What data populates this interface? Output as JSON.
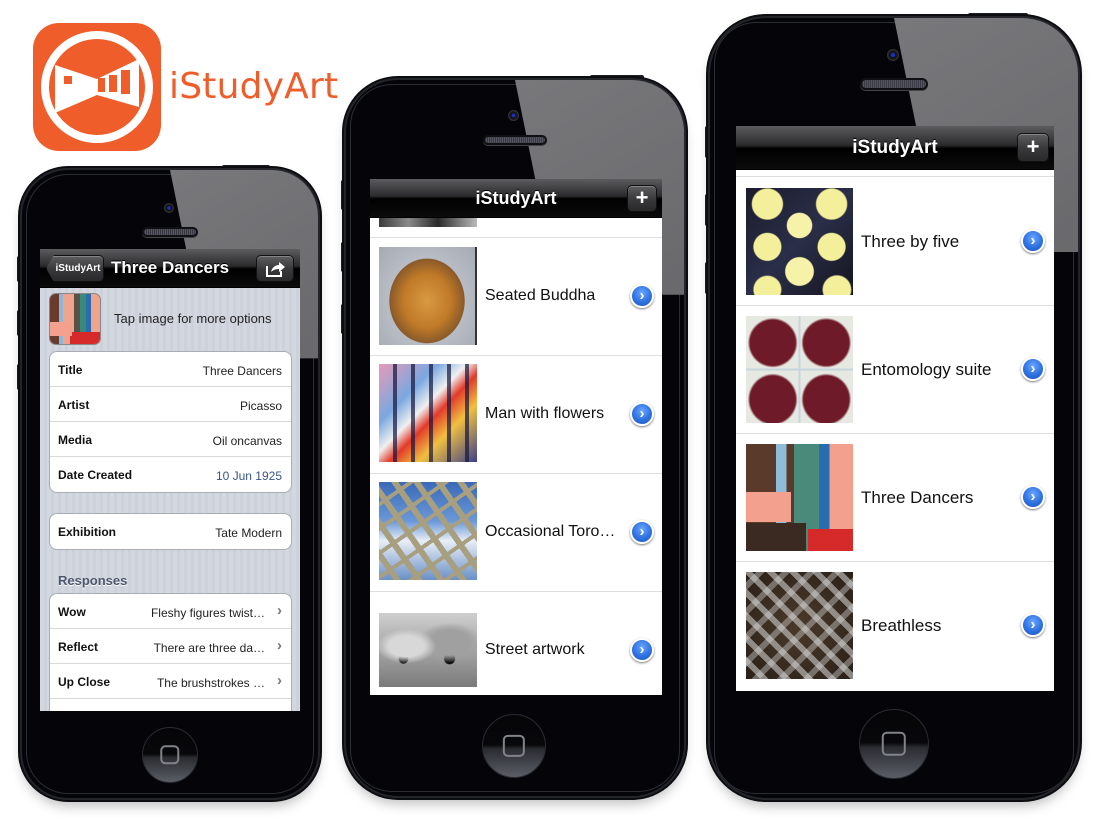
{
  "brand": {
    "name": "iStudyArt",
    "color": "#ef5d2b",
    "icon": "istudyart-logo-icon"
  },
  "phone_left": {
    "navbar": {
      "back_label": "iStudyArt",
      "title": "Three Dancers",
      "share_icon": "share-icon"
    },
    "header": {
      "thumbnail": "three-dancers-thumbnail",
      "hint": "Tap image for more options"
    },
    "details": [
      {
        "label": "Title",
        "value": "Three Dancers"
      },
      {
        "label": "Artist",
        "value": "Picasso"
      },
      {
        "label": "Media",
        "value": "Oil oncanvas"
      },
      {
        "label": "Date Created",
        "value": "10 Jun 1925"
      }
    ],
    "exhibition": {
      "label": "Exhibition",
      "value": "Tate Modern"
    },
    "responses_header": "Responses",
    "responses": [
      {
        "label": "Wow",
        "value": "Fleshy figures twist…"
      },
      {
        "label": "Reflect",
        "value": "There are three da…"
      },
      {
        "label": "Up Close",
        "value": "The brushstrokes …"
      }
    ],
    "accent_date_color": "#3a5688"
  },
  "phone_middle": {
    "navbar": {
      "title": "iStudyArt",
      "add_label": "+"
    },
    "items": [
      {
        "title": "Seated Buddha",
        "thumb": "seated-buddha"
      },
      {
        "title": "Man with flowers",
        "thumb": "man-with-flowers"
      },
      {
        "title": "Occasional Toro…",
        "thumb": "occasional-toro"
      },
      {
        "title": "Street artwork",
        "thumb": "street-artwork"
      }
    ]
  },
  "phone_right": {
    "navbar": {
      "title": "iStudyArt",
      "add_label": "+"
    },
    "items": [
      {
        "title": "Three by five",
        "thumb": "three-by-five"
      },
      {
        "title": "Entomology suite",
        "thumb": "entomology-suite"
      },
      {
        "title": "Three Dancers",
        "thumb": "three-dancers"
      },
      {
        "title": "Breathless",
        "thumb": "breathless"
      }
    ]
  },
  "disclosure_symbol": "›",
  "chevron_symbol": "›"
}
